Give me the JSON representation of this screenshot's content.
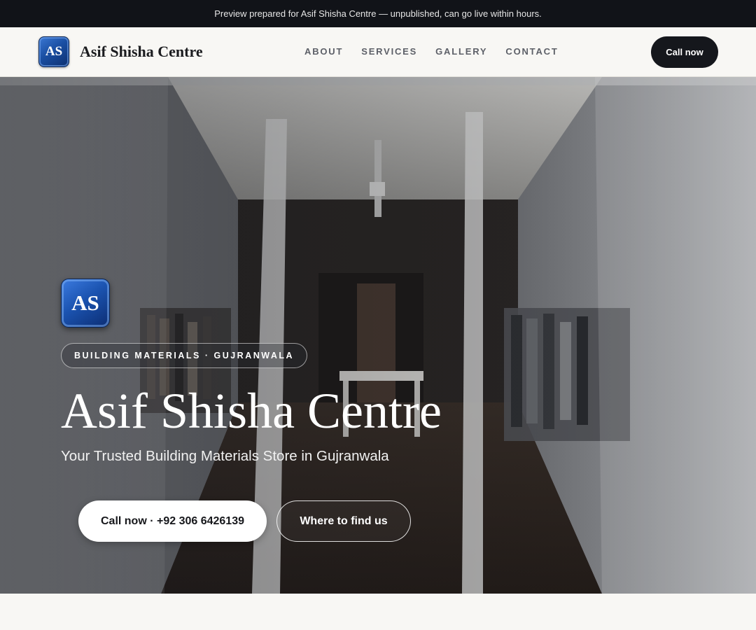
{
  "preview_banner": "Preview prepared for Asif Shisha Centre — unpublished, can go live within hours.",
  "header": {
    "logo_initials": "AS",
    "brand_name": "Asif Shisha Centre",
    "nav": [
      "ABOUT",
      "SERVICES",
      "GALLERY",
      "CONTACT"
    ],
    "cta": "Call now"
  },
  "hero": {
    "logo_initials": "AS",
    "badge": "BUILDING MATERIALS · GUJRANWALA",
    "title": "Asif Shisha Centre",
    "subtitle": "Your Trusted Building Materials Store in Gujranwala",
    "primary_button": "Call now · +92 306 6426139",
    "secondary_button": "Where to find us",
    "background_image": "storefront-photo"
  },
  "colors": {
    "dark": "#111318",
    "accent_blue": "#1b53b0",
    "page_bg": "#f8f7f4"
  }
}
